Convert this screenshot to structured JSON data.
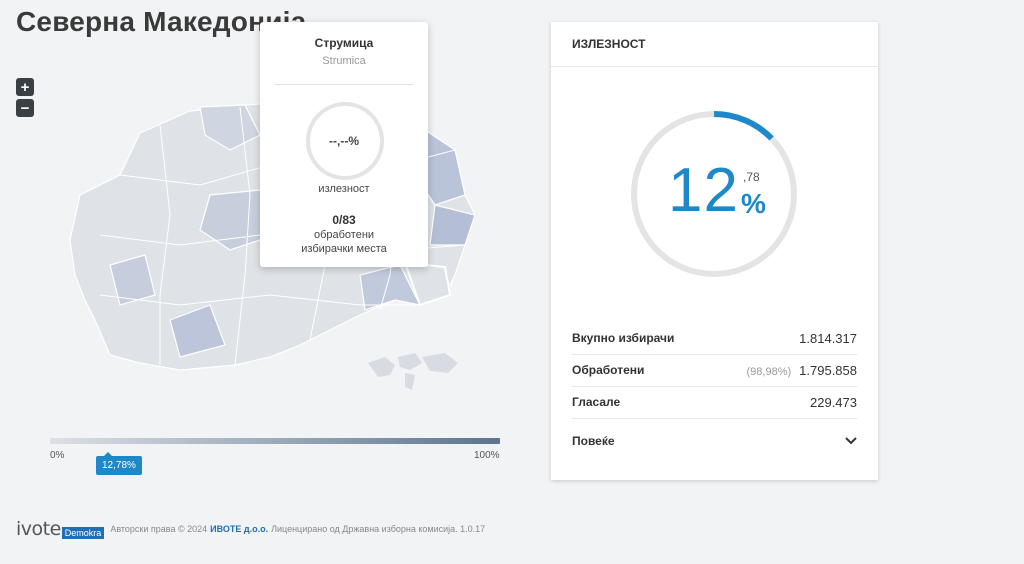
{
  "page": {
    "title": "Северна Македонија"
  },
  "zoom": {
    "in_label": "+",
    "out_label": "−"
  },
  "legend": {
    "min": "0%",
    "max": "100%",
    "current": "12,78%",
    "current_fraction": 0.1278
  },
  "tooltip": {
    "name": "Струмица",
    "name_latin": "Strumica",
    "turnout": "--,--%",
    "turnout_label": "излезност",
    "processed": "0/83",
    "processed_label_1": "обработени",
    "processed_label_2": "избирачки места"
  },
  "panel": {
    "title": "ИЗЛЕЗНОСТ",
    "turnout_int": "12",
    "turnout_dec": ",78",
    "turnout_pct": "%",
    "turnout_fraction": 0.1278,
    "rows": [
      {
        "label": "Вкупно избирачи",
        "extra": "",
        "value": "1.814.317"
      },
      {
        "label": "Обработени",
        "extra": "(98,98%)",
        "value": "1.795.858"
      },
      {
        "label": "Гласале",
        "extra": "",
        "value": "229.473"
      }
    ],
    "more_label": "Повеќе"
  },
  "footer": {
    "logo_main": "ivote",
    "logo_tag": "Demokra",
    "copyright": "Авторски права © 2024",
    "company": "ИВОТЕ д.о.о.",
    "license": "Лиценцирано од Државна изборна комисија. 1.0.17"
  },
  "colors": {
    "accent": "#1e88c9",
    "ring_track": "#e4e4e4",
    "map_light": "#dfe2e6",
    "map_dark": "#b7c1d4"
  }
}
